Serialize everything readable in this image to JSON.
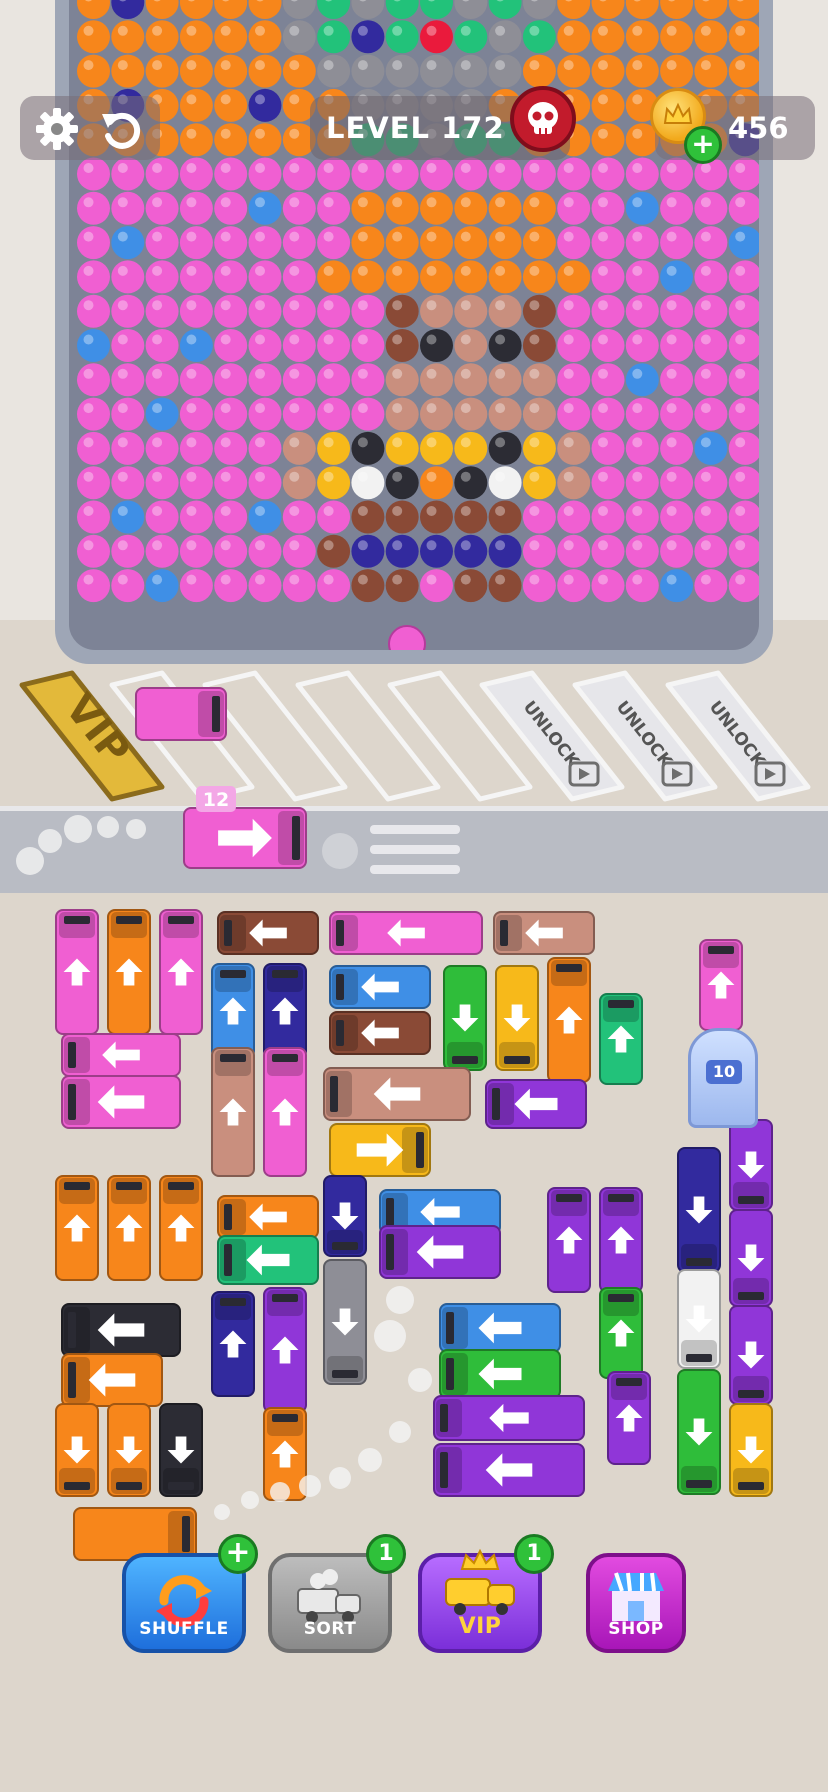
{
  "header": {
    "level_label": "LEVEL 172",
    "coins": "456"
  },
  "dock": {
    "vip_slot_label": "VIP",
    "locked_slot_label": "UNLOCK",
    "incoming_truck_count": "12"
  },
  "lot": {
    "wash_count": "10"
  },
  "buttons": {
    "shuffle": "SHUFFLE",
    "sort": "SORT",
    "sort_count": "1",
    "vip": "VIP",
    "vip_count": "1",
    "shop": "SHOP"
  },
  "colors": {
    "pink": "#f05fd2",
    "orange": "#f7861b",
    "blue": "#3f8fe6",
    "navy": "#322a9e",
    "purple": "#9036d8",
    "green": "#2fbd3a",
    "teal": "#22c27a",
    "yellow": "#f7b91a",
    "brown": "#8a4a36",
    "rose": "#c98f7e",
    "black": "#2c2c34",
    "gray": "#8e8e96",
    "white": "#f2f2f2",
    "red": "#ea1a3c"
  }
}
